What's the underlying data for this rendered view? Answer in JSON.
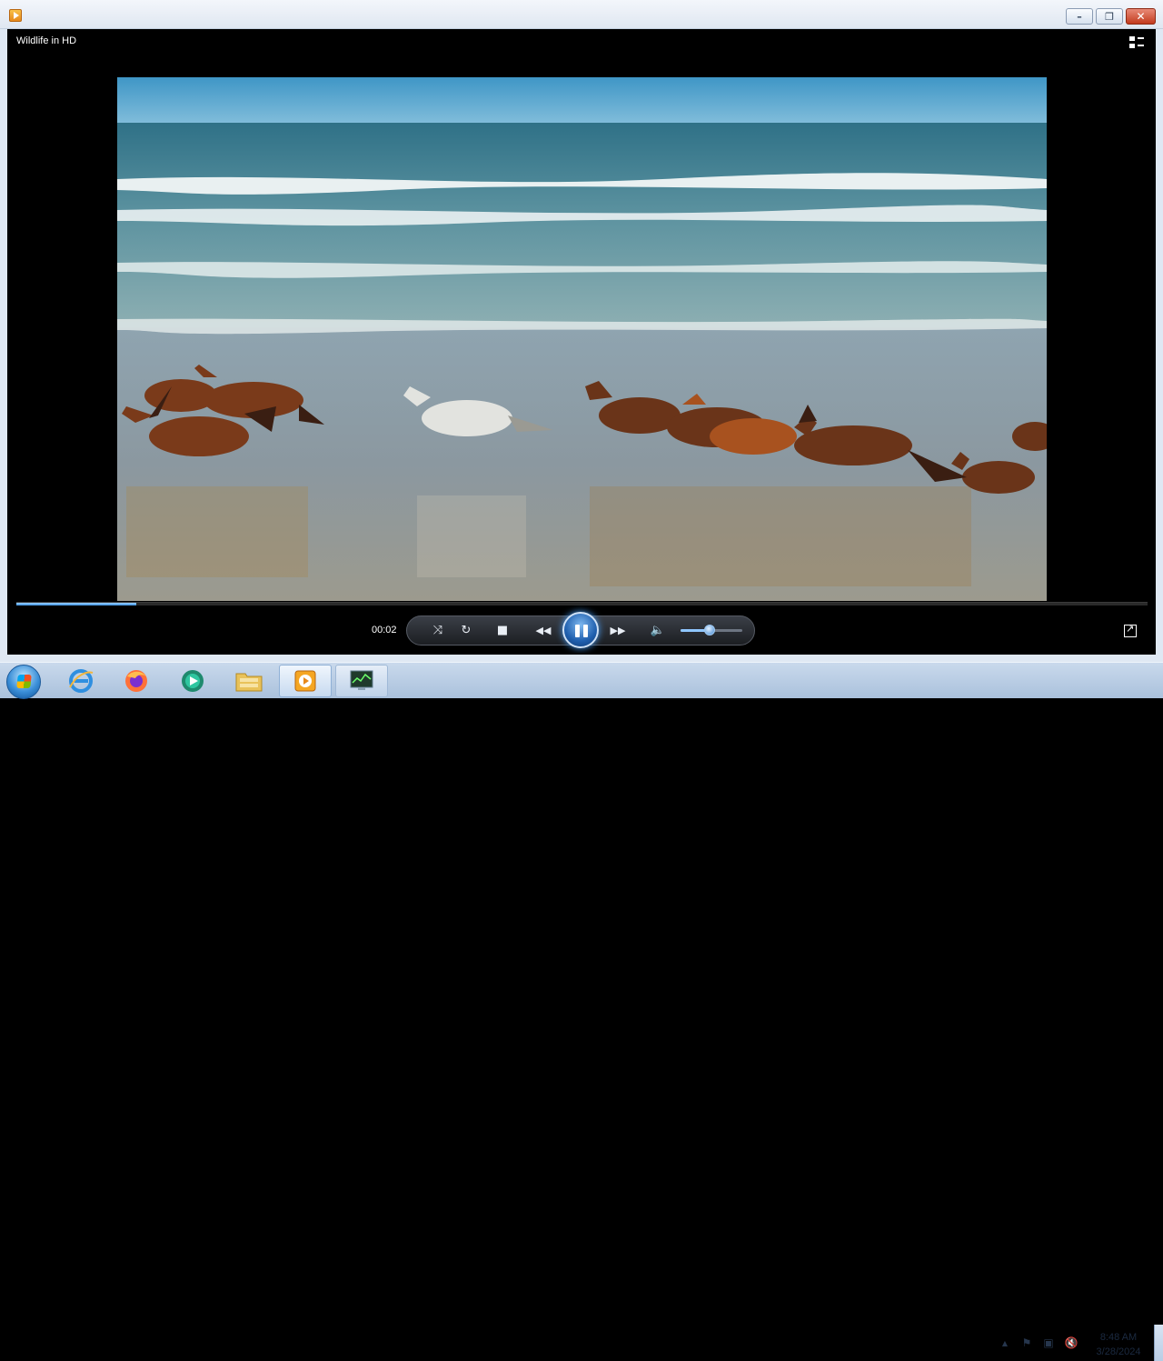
{
  "window": {
    "title_bar_text": "",
    "controls": {
      "minimize": "minimize",
      "maximize": "maximize",
      "close": "close"
    }
  },
  "player": {
    "media_title": "Wildlife in HD",
    "current_time": "00:02",
    "progress_fraction": 0.106,
    "volume_fraction": 0.5,
    "state": "playing",
    "icons": {
      "switch_view": "switch-to-library-icon",
      "shuffle": "shuffle-icon",
      "repeat": "repeat-icon",
      "stop": "stop-icon",
      "previous": "rewind-icon",
      "play_pause": "pause-icon",
      "next": "fast-forward-icon",
      "mute": "speaker-icon",
      "fullscreen": "fullscreen-icon"
    },
    "glyphs": {
      "shuffle": "⤨",
      "repeat": "↻",
      "stop": "■",
      "previous": "◀◀",
      "next": "▶▶",
      "mute": "🔈"
    }
  },
  "taskbar": {
    "pinned": [
      {
        "name": "internet-explorer",
        "icon": "ie-icon"
      },
      {
        "name": "firefox",
        "icon": "firefox-icon"
      },
      {
        "name": "media-center",
        "icon": "media-center-icon"
      },
      {
        "name": "file-explorer",
        "icon": "folder-icon"
      },
      {
        "name": "windows-media-player",
        "icon": "media-player-icon",
        "active": true
      },
      {
        "name": "task-manager",
        "icon": "task-manager-icon"
      }
    ],
    "tray": {
      "show_hidden": "▲",
      "action_center": "⚑",
      "network": "▣",
      "volume_muted": "🔇"
    },
    "clock": {
      "time": "8:48 AM",
      "date": "3/28/2024"
    }
  },
  "colors": {
    "accent": "#3a8fe0",
    "close_button": "#c23b1e",
    "taskbar": "#aac1dc"
  }
}
